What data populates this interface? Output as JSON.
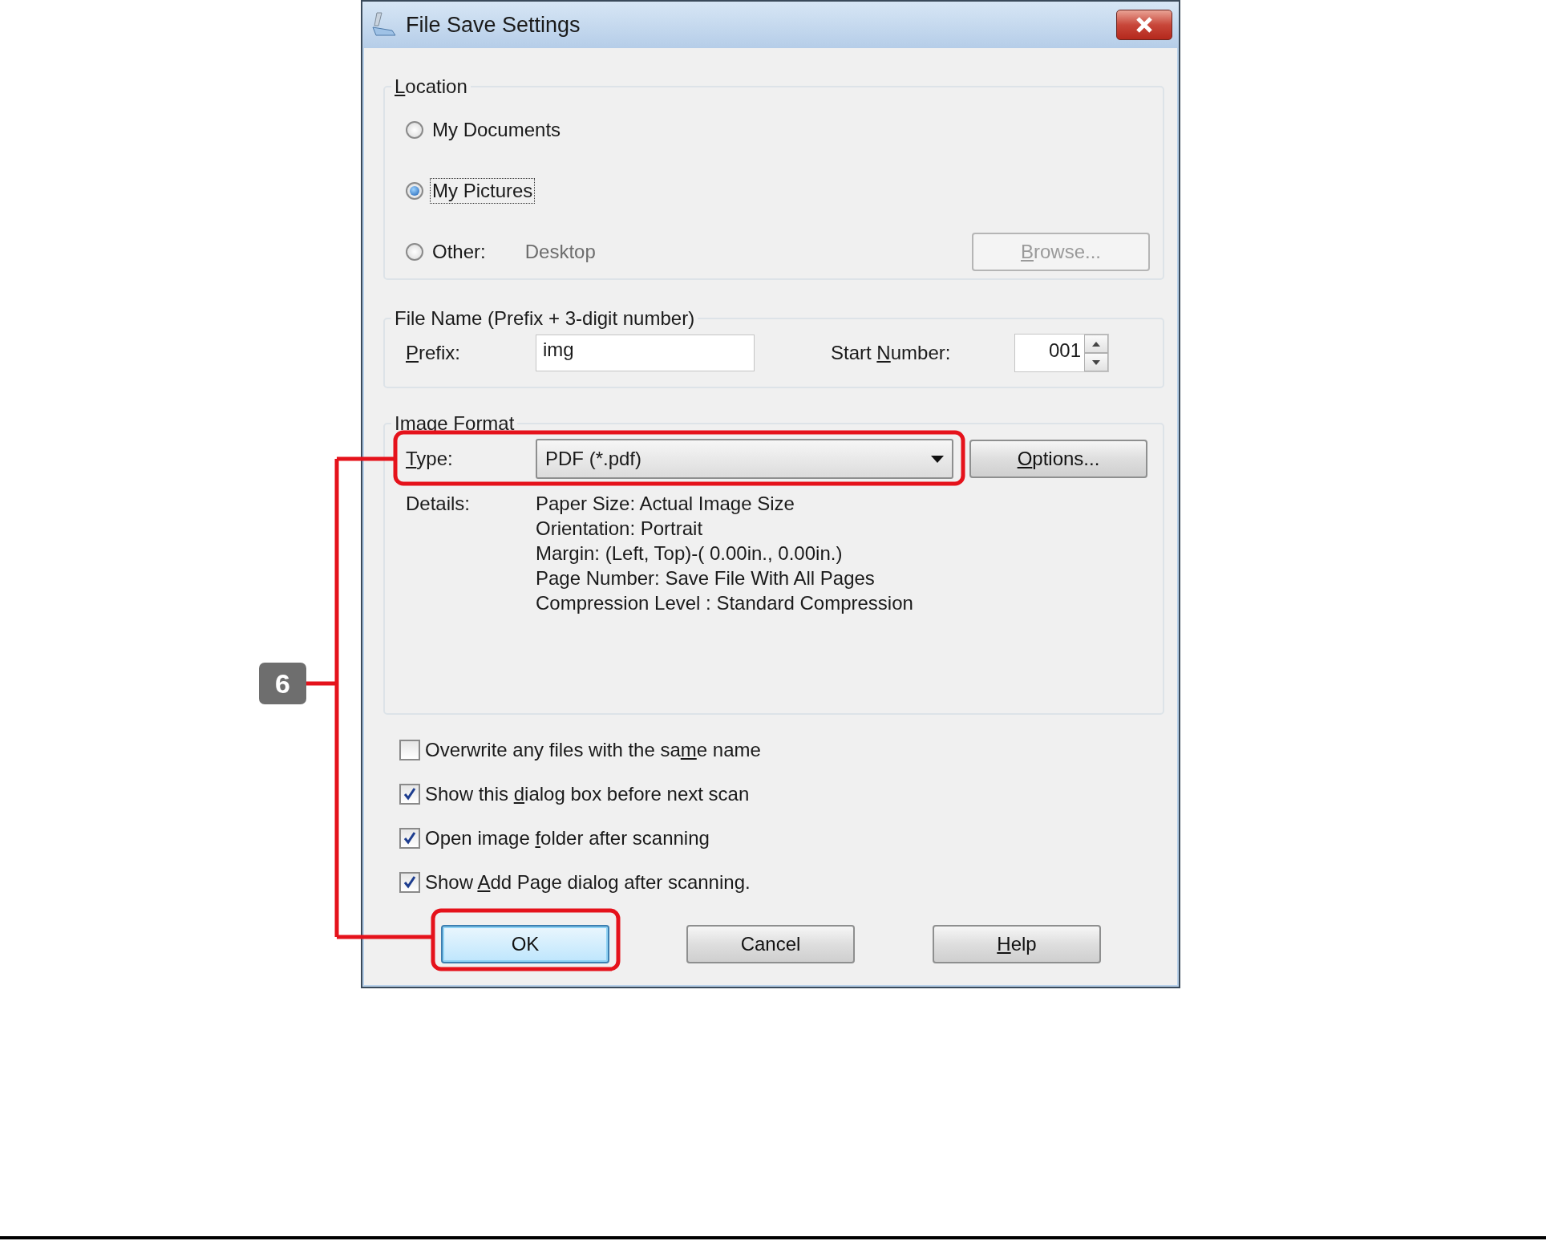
{
  "window": {
    "title": "File Save Settings"
  },
  "location": {
    "legend": {
      "key": "L",
      "after": "ocation"
    },
    "options": [
      {
        "label": "My Documents",
        "selected": false,
        "focused": false
      },
      {
        "label": "My Pictures",
        "selected": true,
        "focused": true
      },
      {
        "label": "Other:",
        "selected": false,
        "focused": false,
        "value": "Desktop"
      }
    ],
    "browse_button": {
      "label": {
        "key": "B",
        "after": "rowse..."
      },
      "disabled": true
    }
  },
  "file_name": {
    "legend": "File Name (Prefix + 3-digit number)",
    "prefix_label": {
      "key": "P",
      "after": "refix:"
    },
    "prefix_value": "img",
    "start_label": {
      "before": "Start ",
      "key": "N",
      "after": "umber:"
    },
    "start_value": "001"
  },
  "image_format": {
    "legend": "Image Format",
    "type_label": {
      "key": "T",
      "after": "ype:"
    },
    "type_value": "PDF (*.pdf)",
    "options_button": {
      "label": {
        "key": "O",
        "after": "ptions..."
      },
      "disabled": false
    },
    "details_label": "Details:",
    "details": [
      "Paper Size: Actual Image Size",
      "Orientation: Portrait",
      "Margin: (Left, Top)-( 0.00in., 0.00in.)",
      "Page Number: Save File With All Pages",
      "Compression Level : Standard Compression"
    ]
  },
  "checkboxes": [
    {
      "label": {
        "before": "Overwrite any files with the sa",
        "key": "m",
        "after": "e name"
      },
      "checked": false
    },
    {
      "label": {
        "before": "Show this ",
        "key": "d",
        "after": "ialog box before next scan"
      },
      "checked": true
    },
    {
      "label": {
        "before": "Open image ",
        "key": "f",
        "after": "older after scanning"
      },
      "checked": true
    },
    {
      "label": {
        "before": "Show ",
        "key": "A",
        "after": "dd Page dialog after scanning."
      },
      "checked": true
    }
  ],
  "buttons": [
    {
      "label": "OK",
      "default": true
    },
    {
      "label": "Cancel",
      "default": false
    },
    {
      "label": {
        "key": "H",
        "after": "elp"
      },
      "default": false
    }
  ],
  "callout": {
    "number": "6"
  }
}
